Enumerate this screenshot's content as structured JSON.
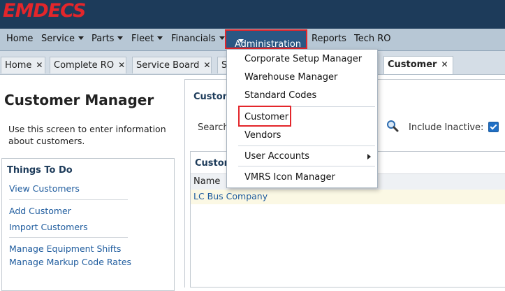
{
  "app": {
    "logo_text": "EMDECS"
  },
  "nav": {
    "home": "Home",
    "service": "Service",
    "parts": "Parts",
    "fleet": "Fleet",
    "financials": "Financials",
    "administration": "Administration",
    "reports": "Reports",
    "tech_ro": "Tech RO"
  },
  "tabs": [
    {
      "label": "Home"
    },
    {
      "label": "Complete RO"
    },
    {
      "label": "Service Board"
    },
    {
      "label": "S"
    },
    {
      "label": "Customer"
    }
  ],
  "left": {
    "page_title": "Customer Manager",
    "intro": "Use this screen to enter information about customers.",
    "todo_title": "Things To Do",
    "links": {
      "view": "View Customers",
      "add": "Add Customer",
      "import": "Import Customers",
      "equipment_shifts": "Manage Equipment Shifts",
      "markup_rates": "Manage Markup Code Rates"
    }
  },
  "right": {
    "panel_title": "Custom",
    "search_label": "Search",
    "include_inactive_label": "Include Inactive:",
    "include_inactive_checked": true,
    "grid_title": "Custom",
    "column_name": "Name",
    "rows": [
      "LC Bus Company"
    ]
  },
  "menu": {
    "items": [
      "Corporate Setup Manager",
      "Warehouse Manager",
      "Standard Codes",
      "Customer",
      "Vendors",
      "User Accounts",
      "VMRS Icon Manager"
    ]
  },
  "colors": {
    "brand_red": "#e3262b",
    "brand_navy": "#1d3b5a",
    "nav_bg": "#b7c7d5",
    "link": "#1f5c9e"
  }
}
